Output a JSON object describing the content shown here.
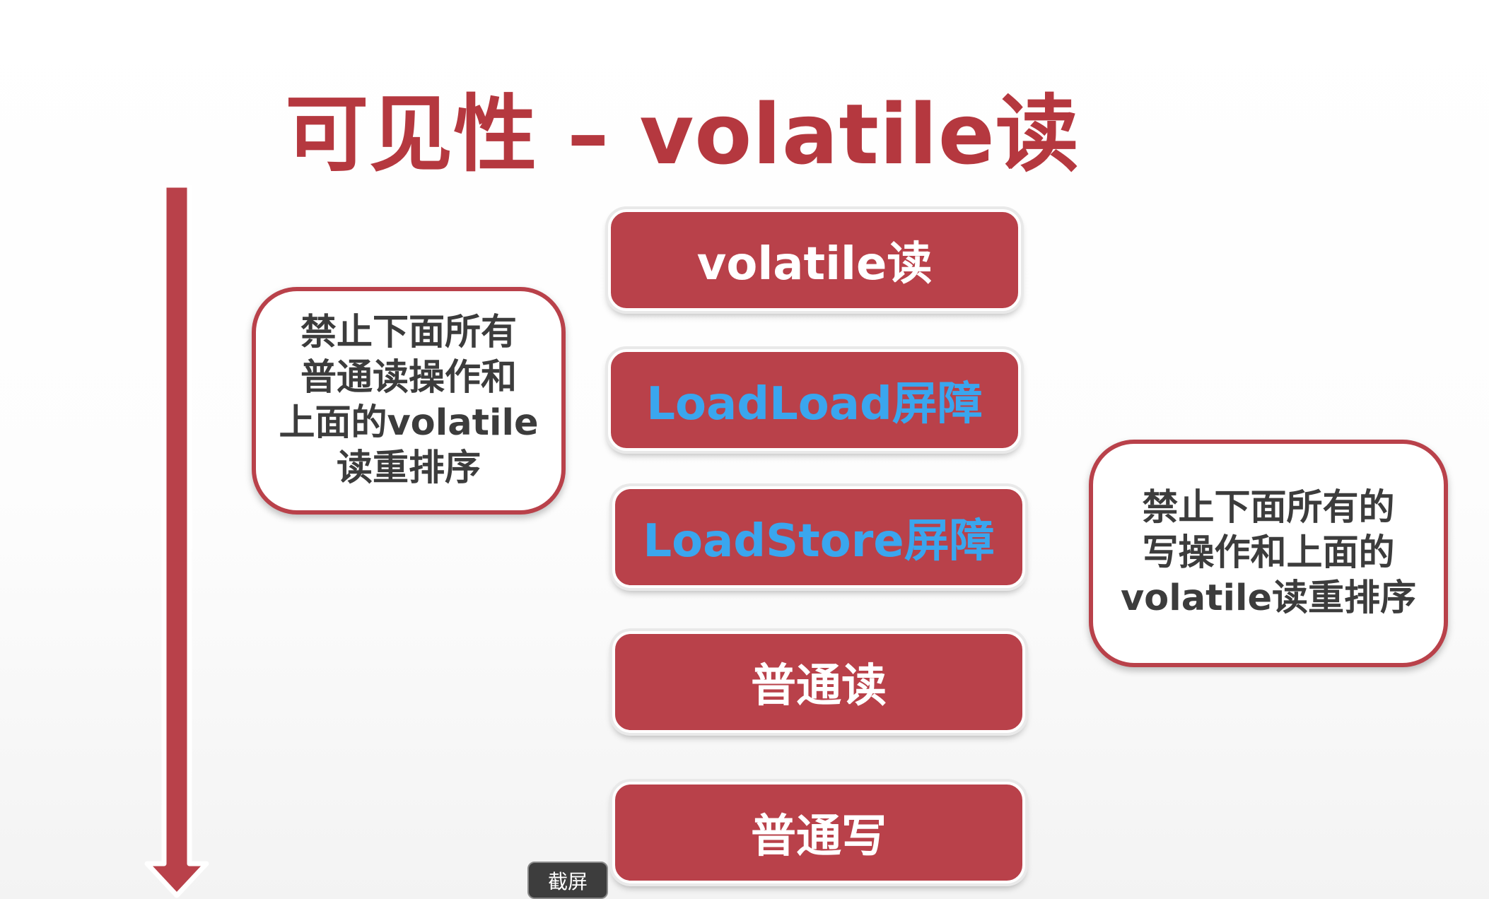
{
  "title": "可见性 – volatile读",
  "timeline": {
    "colors": {
      "arrow": "#b9414a",
      "arrow_outline": "#ffffff"
    }
  },
  "steps": [
    {
      "label": "volatile读",
      "color": "#ffffff"
    },
    {
      "label": "LoadLoad屏障",
      "color": "#3aa6ee"
    },
    {
      "label": "LoadStore屏障",
      "color": "#3aa6ee"
    },
    {
      "label": "普通读",
      "color": "#ffffff"
    },
    {
      "label": "普通写",
      "color": "#ffffff"
    }
  ],
  "notes": {
    "left": {
      "lines": [
        "禁止下面所有",
        "普通读操作和",
        "上面的volatile",
        "读重排序"
      ]
    },
    "right": {
      "lines": [
        "禁止下面所有的",
        "写操作和上面的",
        "volatile读重排序"
      ]
    }
  },
  "tooltip": {
    "label": "截屏"
  },
  "colors": {
    "accent": "#b9414a",
    "title": "#b5383f",
    "barrier_text": "#3aa6ee",
    "note_text": "#3c3c3c"
  }
}
